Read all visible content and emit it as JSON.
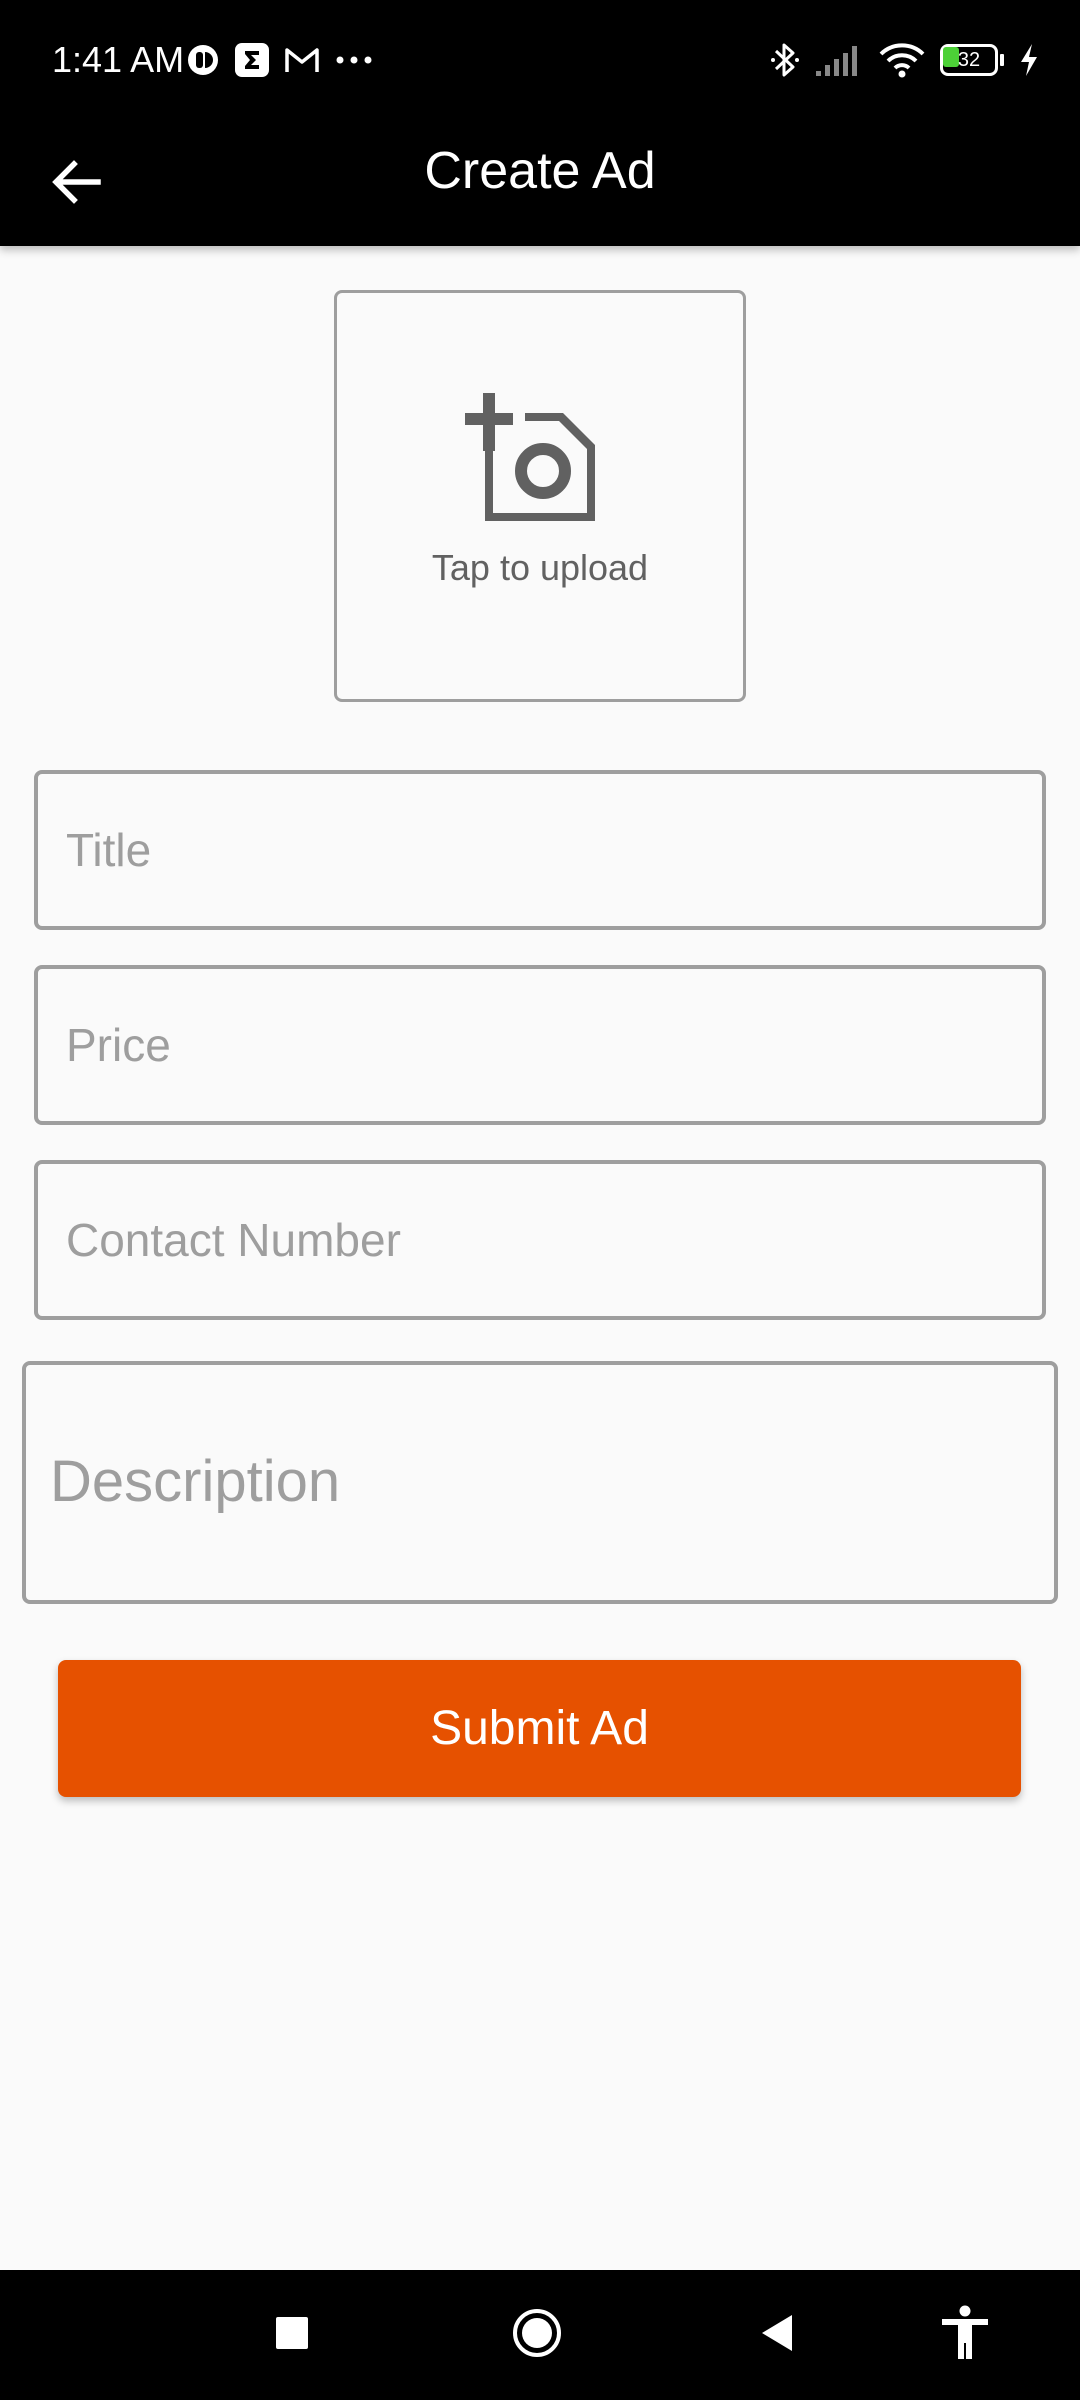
{
  "status_bar": {
    "time": "1:41 AM",
    "battery_level": "32",
    "left_icons": [
      "app-notification-icon",
      "sigma-app-icon",
      "gmail-icon",
      "more-notifications-icon"
    ],
    "right_icons": [
      "bluetooth-icon",
      "signal-icon",
      "wifi-icon",
      "battery-icon",
      "charging-icon"
    ]
  },
  "app_bar": {
    "title": "Create Ad",
    "back_icon": "arrow-back-icon"
  },
  "upload": {
    "icon": "add-photo-icon",
    "label": "Tap to upload"
  },
  "form": {
    "title_placeholder": "Title",
    "price_placeholder": "Price",
    "contact_placeholder": "Contact Number",
    "description_placeholder": "Description",
    "title_value": "",
    "price_value": "",
    "contact_value": "",
    "description_value": ""
  },
  "submit": {
    "label": "Submit Ad",
    "color": "#e65100"
  },
  "nav_bar": {
    "buttons": [
      "recents-icon",
      "home-icon",
      "back-icon",
      "accessibility-icon"
    ]
  },
  "colors": {
    "app_bar": "#000000",
    "background": "#fafafa",
    "border": "#9e9e9e",
    "accent": "#e65100"
  }
}
